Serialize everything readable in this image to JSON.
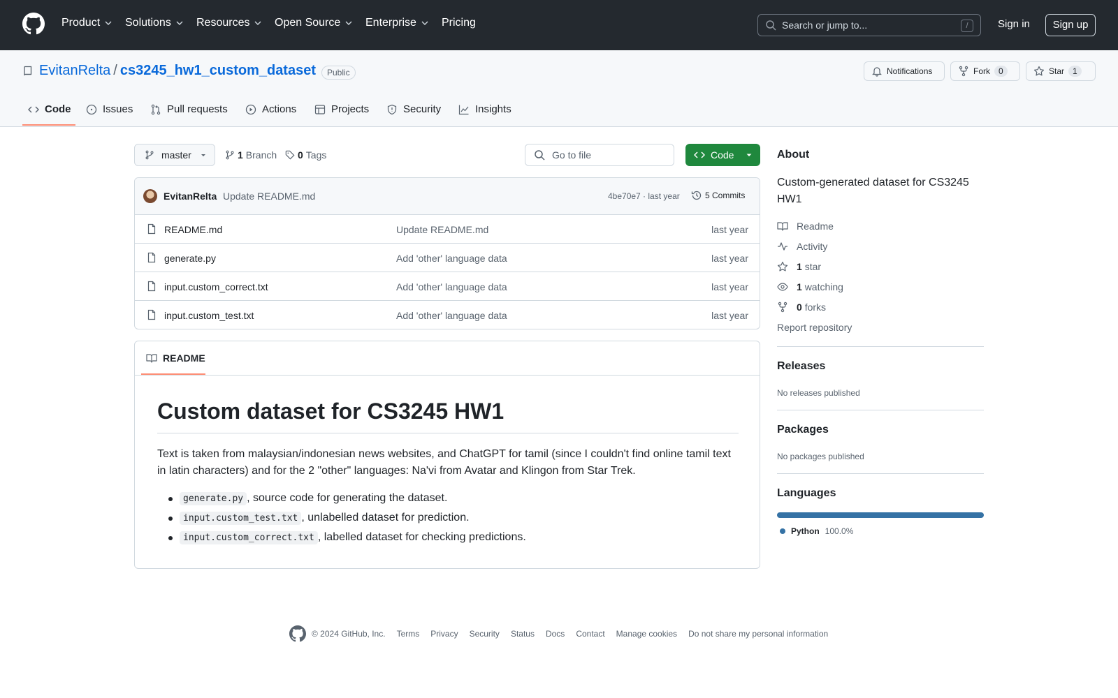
{
  "nav": {
    "items": [
      {
        "label": "Product",
        "has_menu": true
      },
      {
        "label": "Solutions",
        "has_menu": true
      },
      {
        "label": "Resources",
        "has_menu": true
      },
      {
        "label": "Open Source",
        "has_menu": true
      },
      {
        "label": "Enterprise",
        "has_menu": true
      },
      {
        "label": "Pricing",
        "has_menu": false
      }
    ],
    "search_placeholder": "Search or jump to...",
    "search_shortcut": "/",
    "sign_in": "Sign in",
    "sign_up": "Sign up"
  },
  "repo": {
    "owner": "EvitanRelta",
    "separator": "/",
    "name": "cs3245_hw1_custom_dataset",
    "visibility": "Public",
    "notifications_label": "Notifications",
    "fork_label": "Fork",
    "fork_count": "0",
    "star_label": "Star",
    "star_count": "1"
  },
  "tabs": [
    {
      "label": "Code",
      "icon": "code-icon",
      "active": true
    },
    {
      "label": "Issues",
      "icon": "issue-opened-icon",
      "active": false
    },
    {
      "label": "Pull requests",
      "icon": "git-pull-request-icon",
      "active": false
    },
    {
      "label": "Actions",
      "icon": "play-icon",
      "active": false
    },
    {
      "label": "Projects",
      "icon": "table-icon",
      "active": false
    },
    {
      "label": "Security",
      "icon": "shield-icon",
      "active": false
    },
    {
      "label": "Insights",
      "icon": "graph-icon",
      "active": false
    }
  ],
  "toolbar": {
    "branch": "master",
    "branch_count": "1",
    "branch_label": "Branch",
    "tag_count": "0",
    "tag_label": "Tags",
    "go_to_file": "Go to file",
    "code_button": "Code"
  },
  "latest_commit": {
    "author": "EvitanRelta",
    "message": "Update README.md",
    "sha_and_time": "4be70e7 · last year",
    "commits_label": "5 Commits"
  },
  "files": [
    {
      "name": "README.md",
      "commit": "Update README.md",
      "age": "last year"
    },
    {
      "name": "generate.py",
      "commit": "Add 'other' language data",
      "age": "last year"
    },
    {
      "name": "input.custom_correct.txt",
      "commit": "Add 'other' language data",
      "age": "last year"
    },
    {
      "name": "input.custom_test.txt",
      "commit": "Add 'other' language data",
      "age": "last year"
    }
  ],
  "readme": {
    "tab_label": "README",
    "title": "Custom dataset for CS3245 HW1",
    "paragraph": "Text is taken from malaysian/indonesian news websites, and ChatGPT for tamil (since I couldn't find online tamil text in latin characters) and for the 2 \"other\" languages: Na'vi from Avatar and Klingon from Star Trek.",
    "list": [
      {
        "code": "generate.py",
        "text": ", source code for generating the dataset."
      },
      {
        "code": "input.custom_test.txt",
        "text": ", unlabelled dataset for prediction."
      },
      {
        "code": "input.custom_correct.txt",
        "text": ", labelled dataset for checking predictions."
      }
    ]
  },
  "about": {
    "heading": "About",
    "description": "Custom-generated dataset for CS3245 HW1",
    "readme": "Readme",
    "activity": "Activity",
    "stars_count": "1",
    "stars_label": "star",
    "watching_count": "1",
    "watching_label": "watching",
    "forks_count": "0",
    "forks_label": "forks",
    "report": "Report repository"
  },
  "releases": {
    "heading": "Releases",
    "empty": "No releases published"
  },
  "packages": {
    "heading": "Packages",
    "empty": "No packages published"
  },
  "languages": {
    "heading": "Languages",
    "items": [
      {
        "name": "Python",
        "percent": "100.0%",
        "color": "#3572a5"
      }
    ]
  },
  "footer": {
    "copyright": "© 2024 GitHub, Inc.",
    "links": [
      "Terms",
      "Privacy",
      "Security",
      "Status",
      "Docs",
      "Contact",
      "Manage cookies",
      "Do not share my personal information"
    ]
  },
  "colors": {
    "header_bg": "#24292f",
    "link": "#0969da",
    "primary_button": "#1f883d",
    "active_tab_underline": "#fd8c73"
  }
}
